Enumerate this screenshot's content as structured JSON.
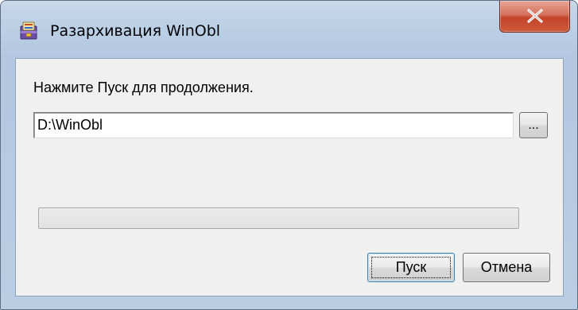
{
  "window": {
    "title": "Разархивация WinObl",
    "icon": "installer-app-icon",
    "close_icon": "close-x-icon",
    "close_color": "#c34328"
  },
  "dialog": {
    "prompt": "Нажмите Пуск для продолжения.",
    "path_value": "D:\\WinObl",
    "browse_label": "...",
    "progress_percent": 0,
    "start_label": "Пуск",
    "cancel_label": "Отмена"
  }
}
